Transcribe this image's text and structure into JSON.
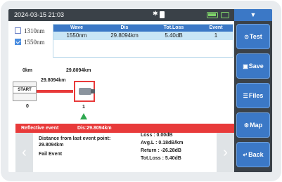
{
  "status": {
    "datetime": "2024-03-15 21:03",
    "bluetooth_icon": "bluetooth-icon",
    "sd_icon": "sd-card-icon",
    "battery_icon": "battery-icon",
    "charge_icon": "charging-icon"
  },
  "wavelengths": [
    {
      "label": "1310nm",
      "checked": false
    },
    {
      "label": "1550nm",
      "checked": true
    }
  ],
  "table": {
    "headers": [
      "Wave",
      "Dis",
      "Tot.Loss",
      "Event"
    ],
    "row": [
      "1550nm",
      "29.8094km",
      "5.40dB",
      "1"
    ]
  },
  "trace": {
    "start_distance": "0km",
    "end_distance": "29.8094km",
    "segment_distance": "29.8094km",
    "start_label": "START",
    "start_index": "0",
    "event_index": "1"
  },
  "event": {
    "title": "Reflective event",
    "distance_label": "Dis:29.8094km",
    "from_last_label": "Distance from last event point:",
    "from_last_value": "29.8094km",
    "result": "Fail Event",
    "loss": "Loss : 0.00dB",
    "avg_loss": "Avg.L : 0.18dB/km",
    "return": "Return : -26.28dB",
    "tot_loss": "Tot.Loss : 5.40dB",
    "prev_glyph": "‹",
    "next_glyph": "›"
  },
  "sidebar": {
    "menu_glyph": "▼",
    "buttons": [
      {
        "label": "Test",
        "icon": "⊙"
      },
      {
        "label": "Save",
        "icon": "▣"
      },
      {
        "label": "Files",
        "icon": "☰"
      },
      {
        "label": "Map",
        "icon": "⚙"
      },
      {
        "label": "Back",
        "icon": "↵"
      }
    ]
  },
  "colors": {
    "accent": "#3b78c6",
    "alert": "#e83a3a",
    "marker": "#2fa84f",
    "battery": "#7fd36a"
  }
}
